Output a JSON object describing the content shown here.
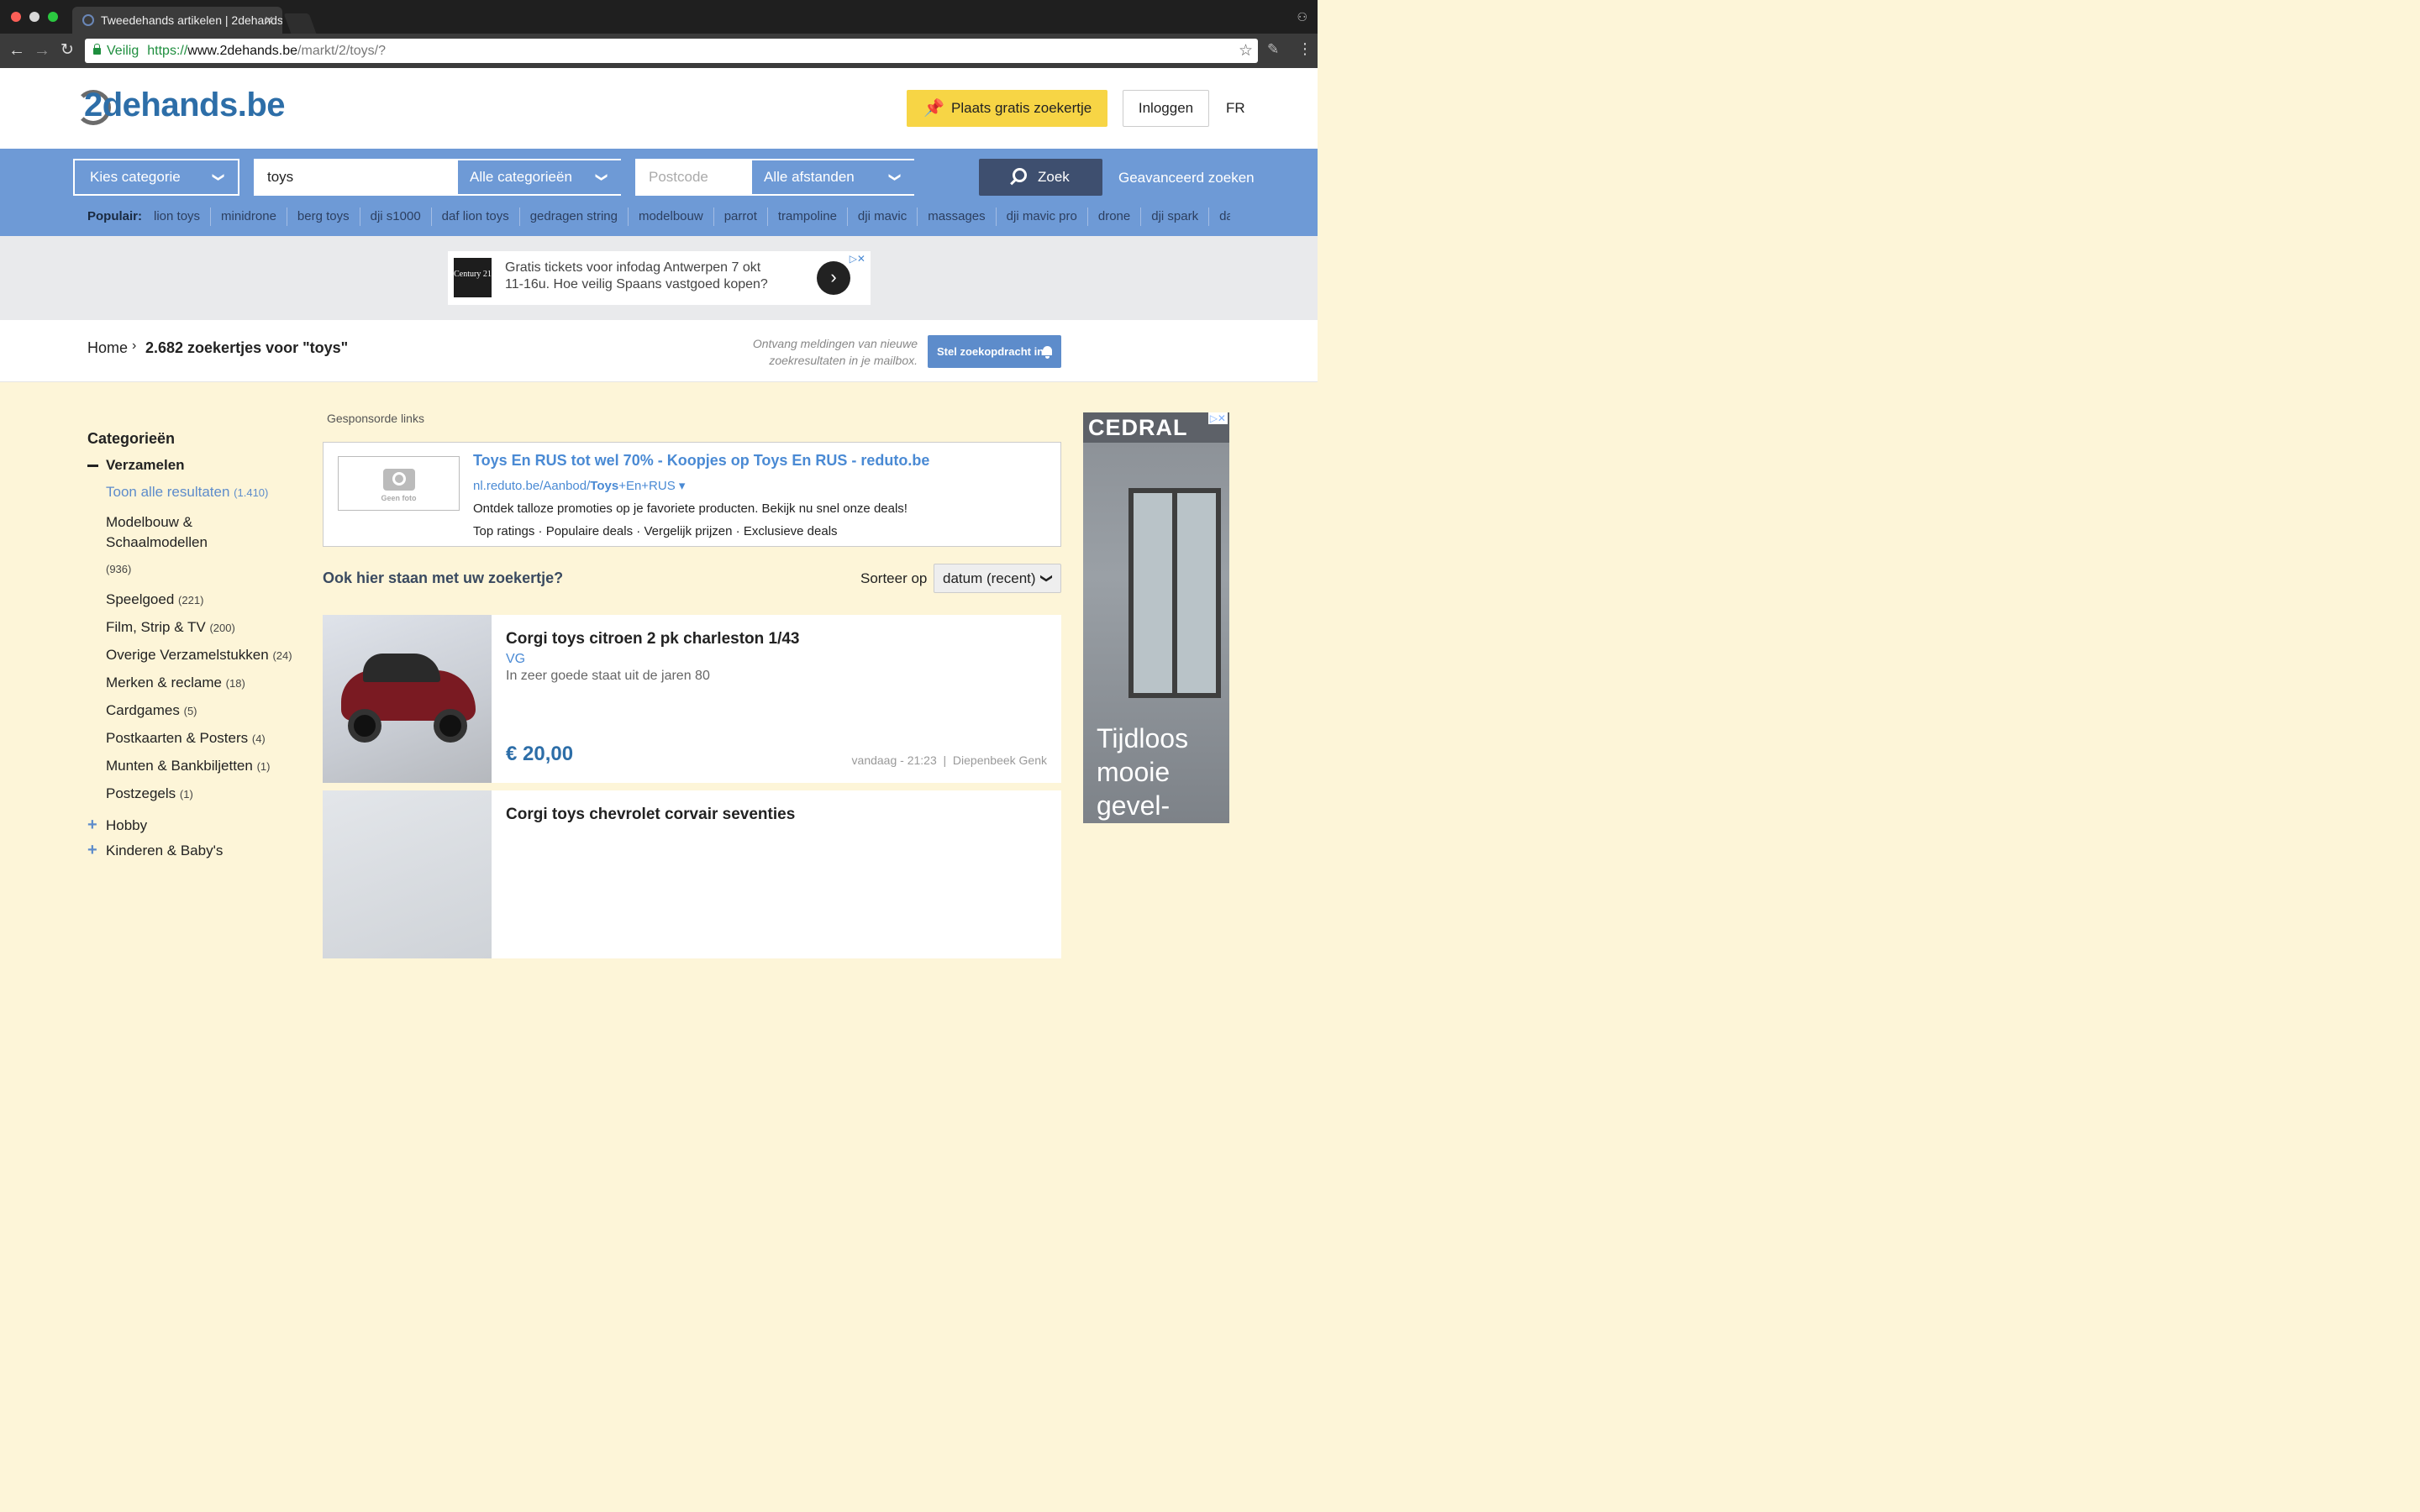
{
  "browser": {
    "tab_title": "Tweedehands artikelen | 2dehands",
    "security_label": "Veilig",
    "url_protocol": "https://",
    "url_host": "www.2dehands.be",
    "url_path": "/markt/2/toys/?"
  },
  "header": {
    "logo_text": "2dehands.be",
    "post_button": "Plaats gratis zoekertje",
    "login_button": "Inloggen",
    "language": "FR"
  },
  "search": {
    "category_select": "Kies categorie",
    "query": "toys",
    "query_category": "Alle categorieën",
    "postcode_placeholder": "Postcode",
    "distance": "Alle afstanden",
    "search_button": "Zoek",
    "advanced_link": "Geavanceerd zoeken",
    "popular_label": "Populair:",
    "popular": [
      "lion toys",
      "minidrone",
      "berg toys",
      "dji s1000",
      "daf lion toys",
      "gedragen string",
      "modelbouw",
      "parrot",
      "trampoline",
      "dji mavic",
      "massages",
      "dji mavic pro",
      "drone",
      "dji spark",
      "da"
    ]
  },
  "top_ad": {
    "logo": "Century 21",
    "line1": "Gratis tickets voor infodag Antwerpen 7 okt",
    "line2": "11-16u. Hoe veilig Spaans vastgoed kopen?"
  },
  "breadcrumb": {
    "home": "Home",
    "current": "2.682 zoekertjes voor \"toys\""
  },
  "alert": {
    "text": "Ontvang meldingen van nieuwe zoekresultaten in je mailbox.",
    "button": "Stel zoekopdracht in"
  },
  "sidebar": {
    "title": "Categorieën",
    "group": "Verzamelen",
    "show_all": "Toon alle resultaten",
    "show_all_count": "(1.410)",
    "items": [
      {
        "label": "Modelbouw & Schaalmodellen",
        "count": "(936)"
      },
      {
        "label": "Speelgoed",
        "count": "(221)"
      },
      {
        "label": "Film, Strip & TV",
        "count": "(200)"
      },
      {
        "label": "Overige Verzamelstukken",
        "count": "(24)"
      },
      {
        "label": "Merken & reclame",
        "count": "(18)"
      },
      {
        "label": "Cardgames",
        "count": "(5)"
      },
      {
        "label": "Postkaarten & Posters",
        "count": "(4)"
      },
      {
        "label": "Munten & Bankbiljetten",
        "count": "(1)"
      },
      {
        "label": "Postzegels",
        "count": "(1)"
      }
    ],
    "collapsed": [
      "Hobby",
      "Kinderen & Baby's"
    ]
  },
  "sponsored": {
    "label": "Gesponsorde links",
    "no_photo": "Geen foto",
    "title": "Toys En RUS tot wel 70% - Koopjes op Toys En RUS - reduto.be",
    "url_pre": "nl.reduto.be/Aanbod/",
    "url_bold": "Toys",
    "url_post": "+En+RUS ▾",
    "description": "Ontdek talloze promoties op je favoriete producten. Bekijk nu snel onze deals!",
    "sitelinks": "Top ratings · Populaire deals · Vergelijk prijzen · Exclusieve deals"
  },
  "listings_header": {
    "promo": "Ook hier staan met uw zoekertje?",
    "sort_label": "Sorteer op",
    "sort_value": "datum (recent)"
  },
  "listings": [
    {
      "title": "Corgi toys citroen 2 pk charleston 1/43",
      "seller": "VG",
      "description": "In zeer goede staat uit de jaren 80",
      "price": "€ 20,00",
      "meta": "vandaag - 21:23  |  Diepenbeek Genk"
    },
    {
      "title": "Corgi toys chevrolet corvair seventies"
    }
  ],
  "side_ad": {
    "brand": "CEDRAL",
    "text_lines": [
      "Tijdloos",
      "mooie",
      "gevel-"
    ]
  }
}
